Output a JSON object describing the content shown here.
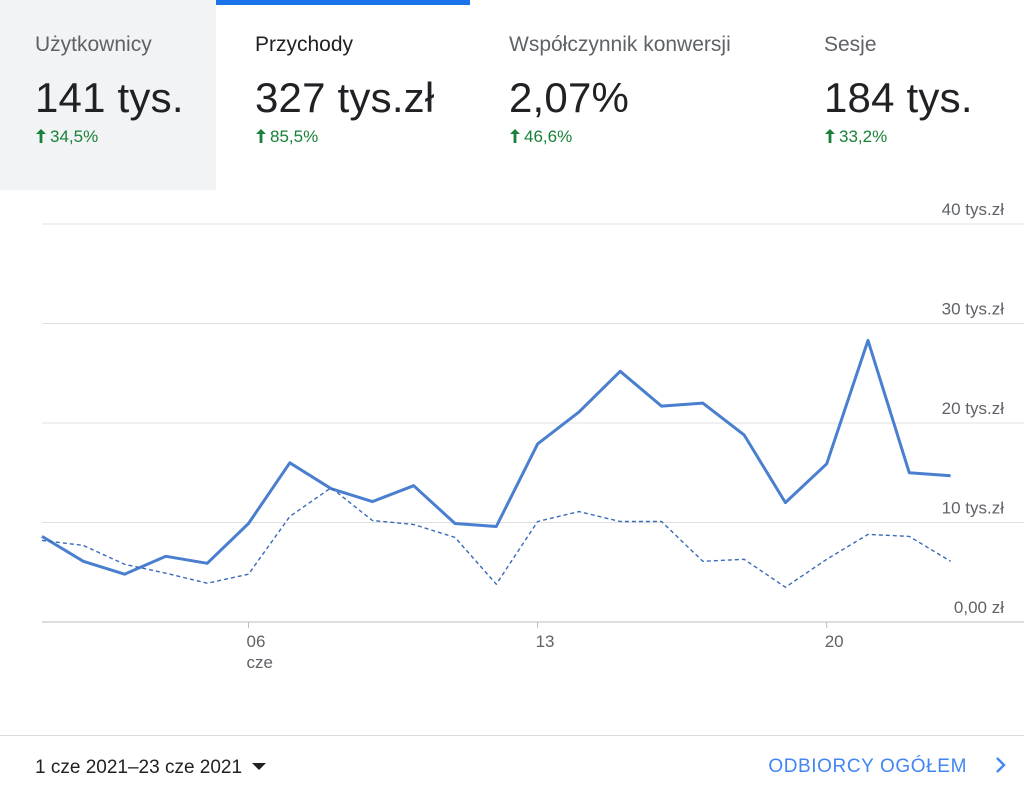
{
  "metric_tabs": [
    {
      "label": "Użytkownicy",
      "value": "141 tys.",
      "change": "34,5%",
      "active": false,
      "selected_bg": true
    },
    {
      "label": "Przychody",
      "value": "327 tys.zł",
      "change": "85,5%",
      "active": true,
      "selected_bg": false
    },
    {
      "label": "Współczynnik konwersji",
      "value": "2,07%",
      "change": "46,6%",
      "active": false,
      "selected_bg": false
    },
    {
      "label": "Sesje",
      "value": "184 tys.",
      "change": "33,2%",
      "active": false,
      "selected_bg": false
    }
  ],
  "footer": {
    "date_range": "1 cze 2021–23 cze 2021",
    "audience_link": "ODBIORCY OGÓŁEM"
  },
  "colors": {
    "accent": "#1a73e8",
    "series_current": "#4a7fcf",
    "series_previous": "#3a6bb8",
    "positive": "#188038",
    "grid": "#e0e0e0"
  },
  "chart_data": {
    "type": "line",
    "x": [
      "2021-06-01",
      "2021-06-02",
      "2021-06-03",
      "2021-06-04",
      "2021-06-05",
      "2021-06-06",
      "2021-06-07",
      "2021-06-08",
      "2021-06-09",
      "2021-06-10",
      "2021-06-11",
      "2021-06-12",
      "2021-06-13",
      "2021-06-14",
      "2021-06-15",
      "2021-06-16",
      "2021-06-17",
      "2021-06-18",
      "2021-06-19",
      "2021-06-20",
      "2021-06-21",
      "2021-06-22",
      "2021-06-23"
    ],
    "series": [
      {
        "style": "solid",
        "values": [
          8600,
          6100,
          4800,
          6600,
          5900,
          9900,
          16000,
          13400,
          12100,
          13700,
          9900,
          9600,
          17900,
          21100,
          25200,
          21700,
          22000,
          18800,
          12000,
          15900,
          28300,
          15000,
          14700
        ]
      },
      {
        "style": "dashed",
        "values": [
          8200,
          7700,
          5800,
          4900,
          3900,
          4800,
          10600,
          13500,
          10200,
          9800,
          8500,
          3800,
          10100,
          11100,
          10100,
          10100,
          6100,
          6300,
          3500,
          6300,
          8800,
          8600,
          6100
        ]
      }
    ],
    "ylim": [
      0,
      40000
    ],
    "y_ticks": [
      {
        "value": 0,
        "label": "0,00 zł"
      },
      {
        "value": 10000,
        "label": "10 tys.zł"
      },
      {
        "value": 20000,
        "label": "20 tys.zł"
      },
      {
        "value": 30000,
        "label": "30 tys.zł"
      },
      {
        "value": 40000,
        "label": "40 tys.zł"
      }
    ],
    "x_ticks": [
      {
        "value": "2021-06-06",
        "label": "06",
        "sublabel": "cze"
      },
      {
        "value": "2021-06-13",
        "label": "13",
        "sublabel": ""
      },
      {
        "value": "2021-06-20",
        "label": "20",
        "sublabel": ""
      }
    ],
    "grid": true,
    "y_axis_side": "right"
  }
}
